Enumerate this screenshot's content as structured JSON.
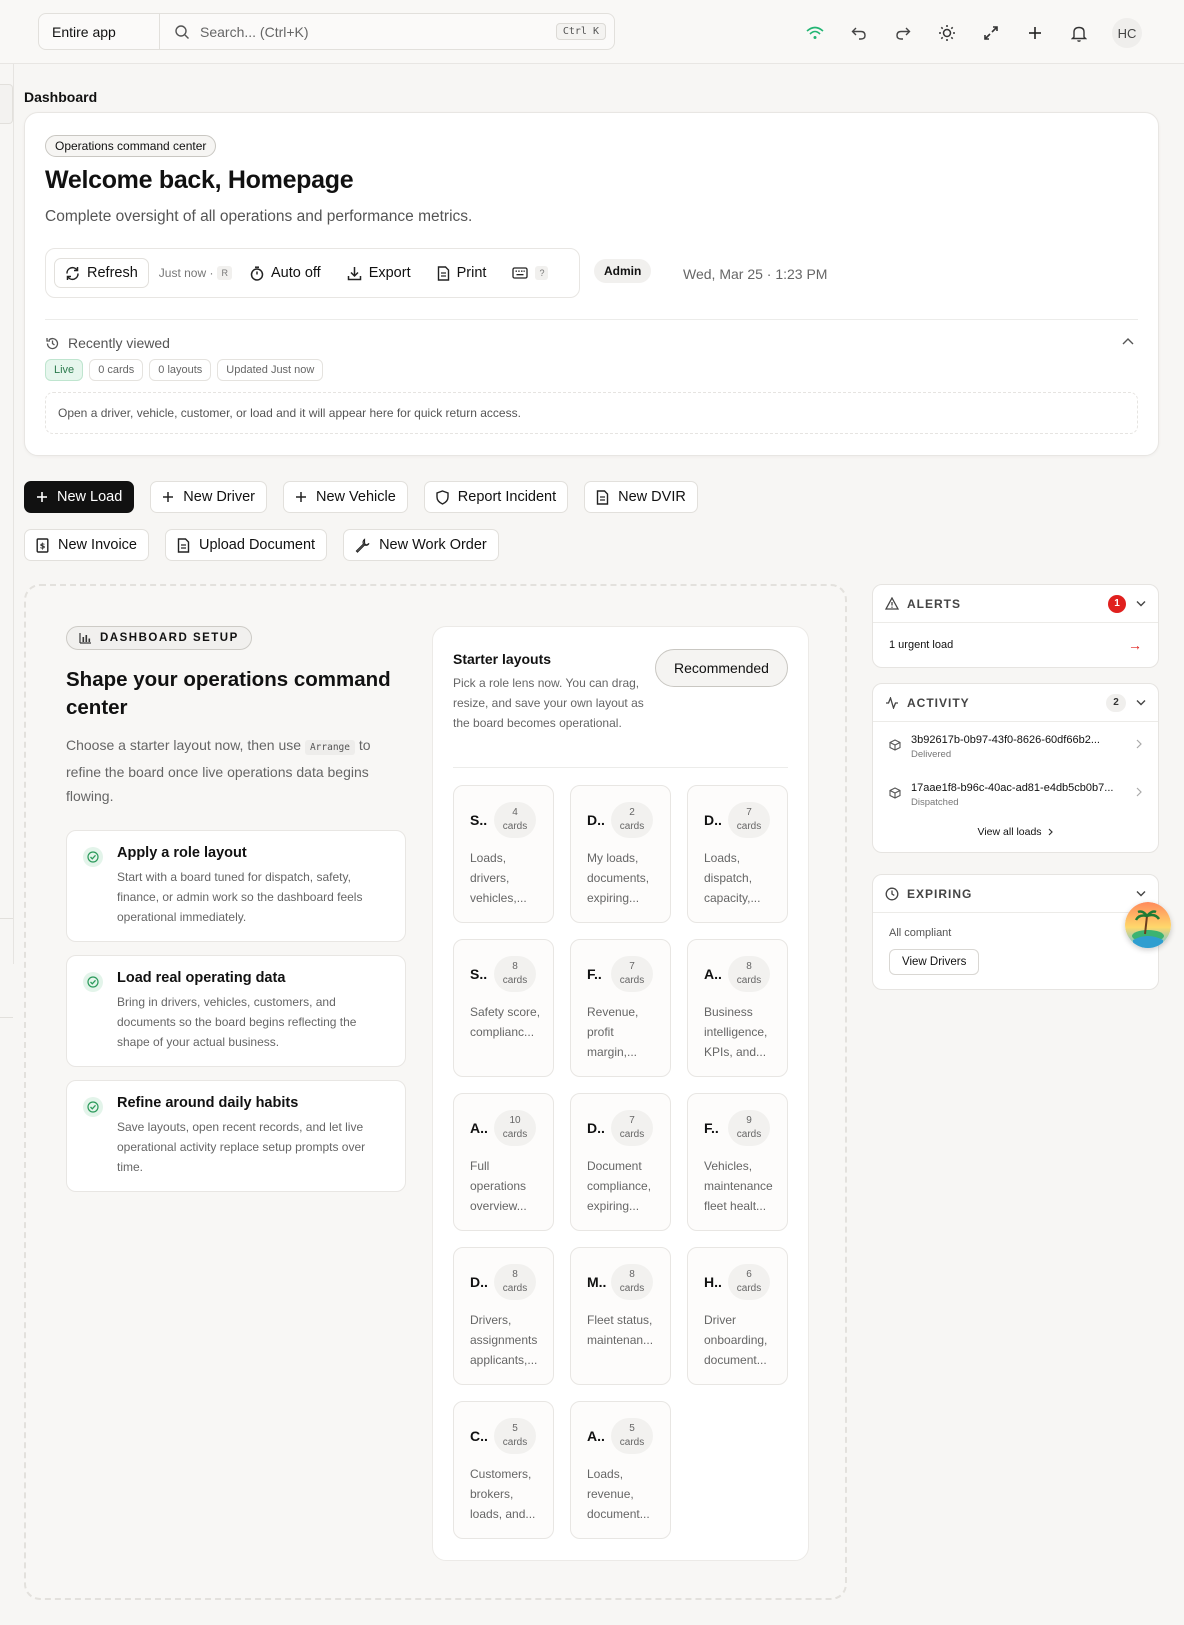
{
  "topbar": {
    "scope_label": "Entire app",
    "search_placeholder": "Search... (Ctrl+K)",
    "shortcut": "Ctrl K",
    "avatar_initials": "HC",
    "icons": [
      "wifi-icon",
      "undo-icon",
      "redo-icon",
      "sun-icon",
      "expand-icon",
      "plus-icon",
      "bell-icon"
    ]
  },
  "breadcrumb": "Dashboard",
  "hero": {
    "pill": "Operations command center",
    "title": "Welcome back, Homepage",
    "subtitle": "Complete oversight of all operations and performance metrics.",
    "toolbar": {
      "refresh": "Refresh",
      "refreshed": "Just now ·",
      "refresh_key": "R",
      "auto": "Auto off",
      "export": "Export",
      "print": "Print",
      "help": "?"
    },
    "role": "Admin",
    "datetime": "Wed, Mar 25 · 1:23 PM",
    "recent": {
      "title": "Recently viewed",
      "chips": [
        "Live",
        "0 cards",
        "0 layouts",
        "Updated Just now"
      ],
      "empty": "Open a driver, vehicle, customer, or load and it will appear here for quick return access."
    }
  },
  "actions": [
    {
      "label": "New Load",
      "icon": "plus-icon"
    },
    {
      "label": "New Driver",
      "icon": "plus-icon"
    },
    {
      "label": "New Vehicle",
      "icon": "plus-icon"
    },
    {
      "label": "Report Incident",
      "icon": "shield-icon"
    },
    {
      "label": "New DVIR",
      "icon": "document-icon"
    },
    {
      "label": "New Invoice",
      "icon": "invoice-icon"
    },
    {
      "label": "Upload Document",
      "icon": "document-icon"
    },
    {
      "label": "New Work Order",
      "icon": "wrench-icon"
    }
  ],
  "setup": {
    "pill": "DASHBOARD SETUP",
    "title": "Shape your operations command center",
    "desc_before": "Choose a starter layout now, then use",
    "desc_code": "Arrange",
    "desc_after": "to refine the board once live operations data begins flowing.",
    "steps": [
      {
        "title": "Apply a role layout",
        "text": "Start with a board tuned for dispatch, safety, finance, or admin work so the dashboard feels operational immediately."
      },
      {
        "title": "Load real operating data",
        "text": "Bring in drivers, vehicles, customers, and documents so the board begins reflecting the shape of your actual business."
      },
      {
        "title": "Refine around daily habits",
        "text": "Save layouts, open recent records, and let live operational activity replace setup prompts over time."
      }
    ],
    "starter": {
      "title": "Starter layouts",
      "desc": "Pick a role lens now. You can drag, resize, and save your own layout as the board becomes operational.",
      "button": "Recommended",
      "cards": [
        {
          "abbr": "S..",
          "count": "4",
          "unit": "cards",
          "desc": "Loads, drivers, vehicles,..."
        },
        {
          "abbr": "D..",
          "count": "2",
          "unit": "cards",
          "desc": "My loads, documents, expiring..."
        },
        {
          "abbr": "D..",
          "count": "7",
          "unit": "cards",
          "desc": "Loads, dispatch, capacity,..."
        },
        {
          "abbr": "S..",
          "count": "8",
          "unit": "cards",
          "desc": "Safety score, complianc..."
        },
        {
          "abbr": "F..",
          "count": "7",
          "unit": "cards",
          "desc": "Revenue, profit margin,..."
        },
        {
          "abbr": "A..",
          "count": "8",
          "unit": "cards",
          "desc": "Business intelligence, KPIs, and..."
        },
        {
          "abbr": "A..",
          "count": "10",
          "unit": "cards",
          "desc": "Full operations overview..."
        },
        {
          "abbr": "D..",
          "count": "7",
          "unit": "cards",
          "desc": "Document compliance, expiring..."
        },
        {
          "abbr": "F..",
          "count": "9",
          "unit": "cards",
          "desc": "Vehicles, maintenance fleet healt..."
        },
        {
          "abbr": "D..",
          "count": "8",
          "unit": "cards",
          "desc": "Drivers, assignments applicants,..."
        },
        {
          "abbr": "M..",
          "count": "8",
          "unit": "cards",
          "desc": "Fleet status, maintenan..."
        },
        {
          "abbr": "H..",
          "count": "6",
          "unit": "cards",
          "desc": "Driver onboarding, document..."
        },
        {
          "abbr": "C..",
          "count": "5",
          "unit": "cards",
          "desc": "Customers, brokers, loads, and..."
        },
        {
          "abbr": "A..",
          "count": "5",
          "unit": "cards",
          "desc": "Loads, revenue, document..."
        }
      ]
    }
  },
  "alerts": {
    "title": "ALERTS",
    "count": "1",
    "item": "1 urgent load",
    "arrow": "→"
  },
  "activity": {
    "title": "ACTIVITY",
    "count": "2",
    "items": [
      {
        "id": "3b92617b-0b97-43f0-8626-60df66b2...",
        "status": "Delivered"
      },
      {
        "id": "17aae1f8-b96c-40ac-ad81-e4db5cb0b7...",
        "status": "Dispatched"
      }
    ],
    "view_all": "View all loads"
  },
  "expiring": {
    "title": "EXPIRING",
    "status": "All compliant",
    "button": "View Drivers"
  },
  "colors": {
    "accent": "#111111",
    "alert": "#e0201e",
    "live_bg": "#e6f6ed",
    "live_fg": "#2b7a4d",
    "wifi": "#22b573"
  }
}
